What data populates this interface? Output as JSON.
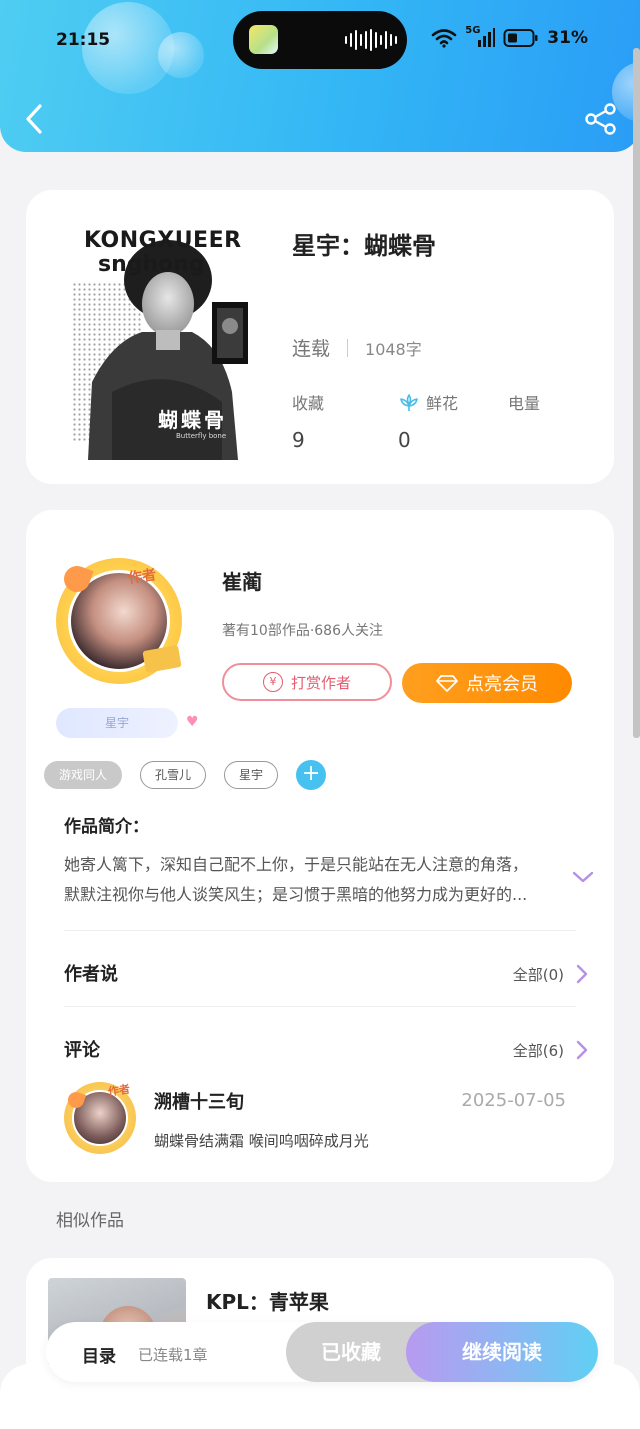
{
  "status_bar": {
    "time": "21:15",
    "network": "5G",
    "battery": "31%"
  },
  "book": {
    "title": "星宇：蝴蝶骨",
    "status": "连载",
    "word_count": "1048字",
    "cover_text_top": "KONGXUEER",
    "cover_text_sub": "snghong",
    "cover_text_title": "蝴蝶骨",
    "cover_text_en": "Butterfly bone",
    "stats": [
      {
        "label": "收藏",
        "value": "9"
      },
      {
        "label": "鲜花",
        "value": "0"
      },
      {
        "label": "电量",
        "value": ""
      }
    ]
  },
  "author": {
    "tag": "作者",
    "name": "崔蔺",
    "info": "著有10部作品·686人关注",
    "badge": "星宇",
    "tip_button": "打赏作者",
    "vip_button": "点亮会员"
  },
  "tags": [
    "游戏同人",
    "孔雪儿",
    "星宇"
  ],
  "intro": {
    "title": "作品简介：",
    "line1": "她寄人篱下，深知自己配不上你，于是只能站在无人注意的角落，",
    "line2": "默默注视你与他人谈笑风生；是习惯于黑暗的他努力成为更好的..."
  },
  "author_says": {
    "title": "作者说",
    "link": "全部(0)"
  },
  "comments": {
    "title": "评论",
    "link": "全部(6)",
    "items": [
      {
        "user": "溯槽十三旬",
        "date": "2025-07-05",
        "text": "蝴蝶骨结满霜 喉间呜咽碎成月光",
        "avatar_tag": "作者"
      }
    ]
  },
  "similar": {
    "title": "相似作品",
    "items": [
      {
        "title": "KPL：青苹果"
      }
    ]
  },
  "bottom_bar": {
    "toc": "目录",
    "toc_sub": "已连载1章",
    "collected": "已收藏",
    "continue": "继续阅读"
  }
}
